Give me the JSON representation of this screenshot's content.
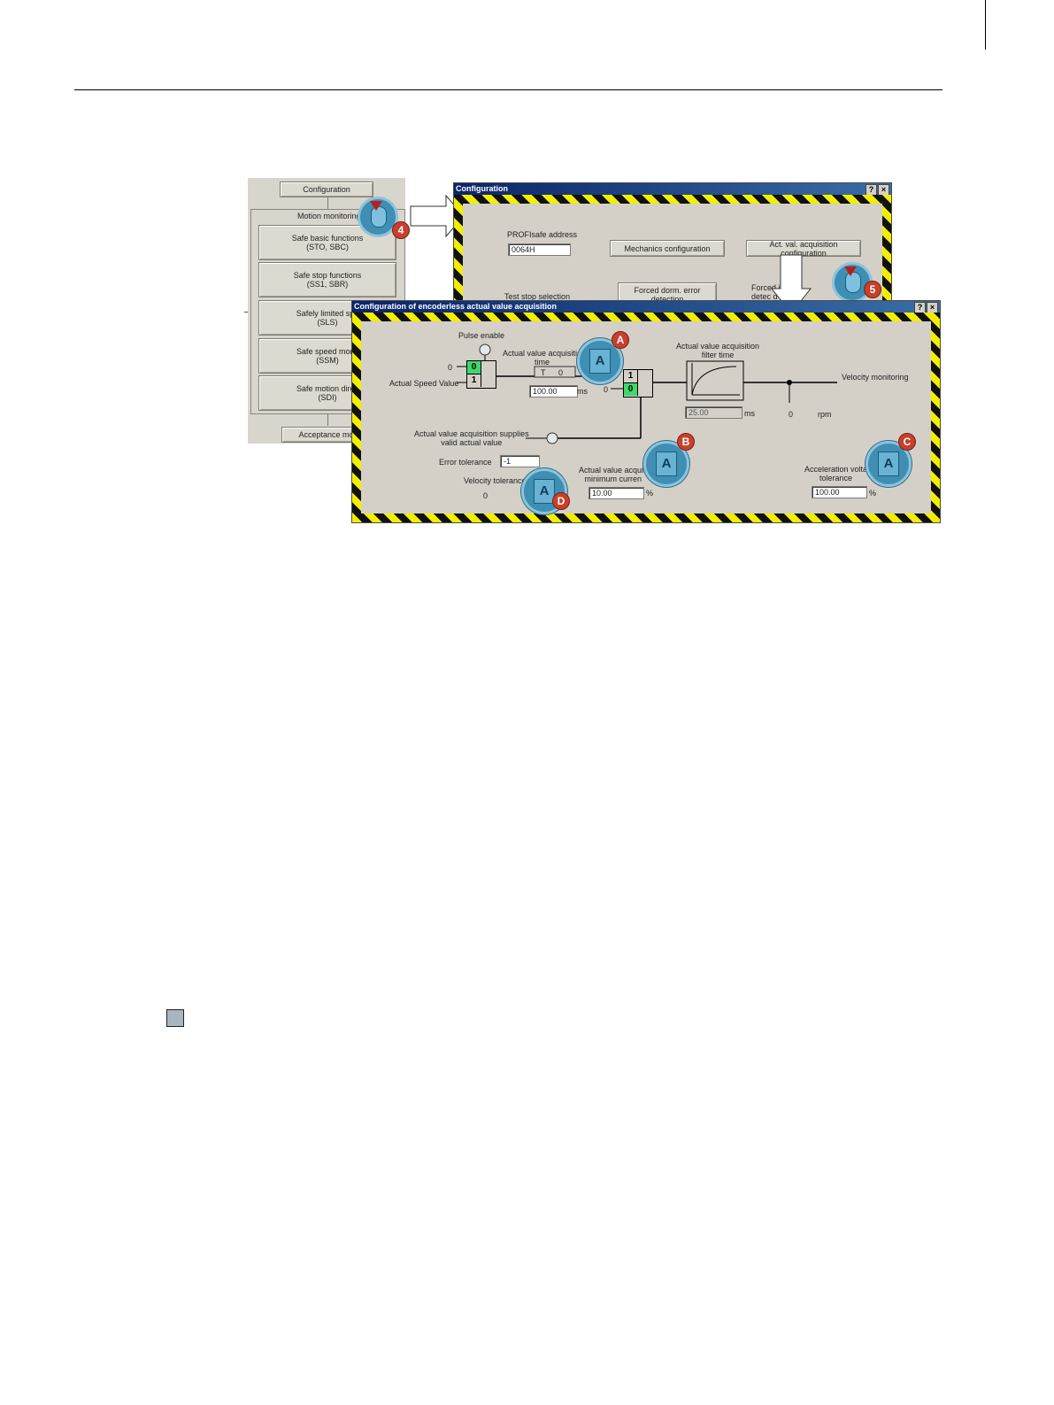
{
  "left_panel": {
    "configuration_button": "Configuration",
    "group_label": "Motion monitoring",
    "buttons": [
      "Safe basic functions\n(STO, SBC)",
      "Safe stop functions\n(SS1, SBR)",
      "Safely limited spe\n(SLS)",
      "Safe speed monit\n(SSM)",
      "Safe motion direc\n(SDI)"
    ],
    "acceptance_button": "Acceptance mod"
  },
  "config_dialog": {
    "title": "Configuration",
    "help": "?",
    "close": "×",
    "profisafe_label": "PROFIsafe address",
    "profisafe_value": "0064H",
    "mechanics_button": "Mechanics configuration",
    "actval_button": "Act. val. acquisition configuration",
    "test_stop_label": "Test stop selection",
    "forced_button": "Forced dorm. error detection",
    "forced2_label": "Forced     it error\ndetec         d"
  },
  "main_dialog": {
    "title": "Configuration of encoderless actual value acquisition",
    "help": "?",
    "close": "×",
    "pulse_enable": "Pulse enable",
    "actual_speed_value": "Actual Speed Value",
    "zero_left": "0",
    "switch1_top": "0",
    "switch1_bottom": "1",
    "acq_time_label": "Actual value acquisitio\ntime",
    "timer_t": "T",
    "timer_0": "0",
    "acq_time_value": "100.00",
    "acq_time_unit": "ms",
    "zero_mid": "0",
    "switch2_top": "1",
    "switch2_bottom": "0",
    "filter_label": "Actual value acquisition\nfilter time",
    "filter_value": "25.00",
    "filter_unit": "ms",
    "velocity_monitoring": "Velocity monitoring",
    "rpm_value": "0",
    "rpm_unit": "rpm",
    "supplies_label": "Actual value acquisition supplies\nvalid actual value",
    "error_tolerance_label": "Error tolerance",
    "error_tolerance_value": "-1",
    "velocity_tolerance_label": "Velocity tolerance",
    "velocity_tolerance_value": "0",
    "min_current_label": "Actual value acquis\nminimum curren",
    "min_current_value": "10.00",
    "min_current_unit": "%",
    "accel_label": "Acceleration volta\ntolerance",
    "accel_value": "100.00",
    "accel_unit": "%"
  },
  "callouts": {
    "step4": "4",
    "step5": "5",
    "a": "A",
    "b": "B",
    "c": "C",
    "d": "D",
    "icon_text": "A"
  },
  "colors": {
    "hazard_yellow": "#f1ee00",
    "switch_green": "#3ed86a",
    "callout_blue": "#3e8fb3",
    "badge_red": "#c8402c",
    "titlebar": "#0a246a"
  }
}
